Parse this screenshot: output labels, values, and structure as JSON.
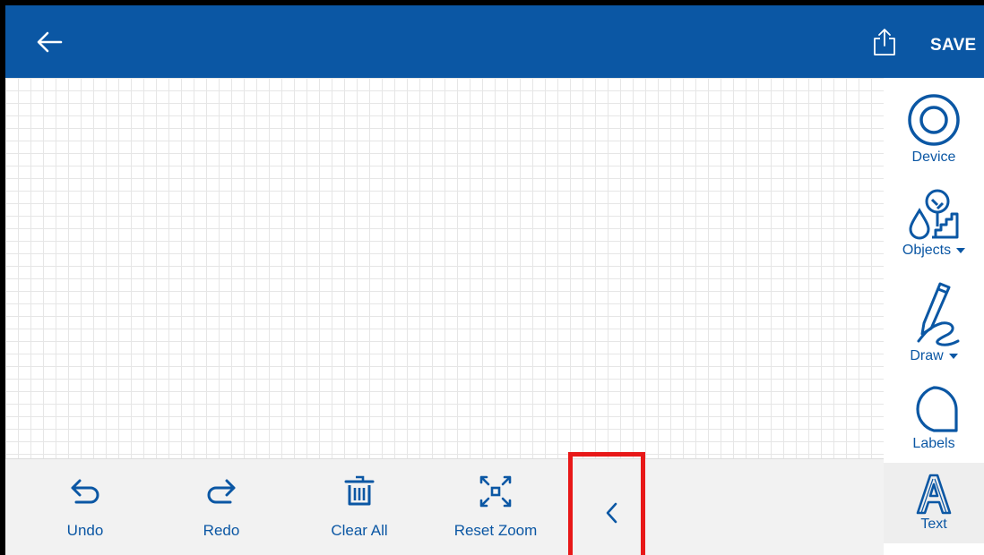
{
  "appbar": {
    "save_label": "SAVE",
    "color": "#0b57a4"
  },
  "sidebar": {
    "device_label": "Device",
    "objects_label": "Objects",
    "draw_label": "Draw",
    "labels_label": "Labels",
    "text_label": "Text",
    "selected": "Text"
  },
  "bottombar": {
    "undo_label": "Undo",
    "redo_label": "Redo",
    "clear_all_label": "Clear All",
    "reset_zoom_label": "Reset Zoom"
  },
  "colors": {
    "accent": "#0b57a4",
    "highlight": "#e81818",
    "toolbar_bg": "#f2f2f2"
  },
  "icons": [
    "back-arrow-icon",
    "share-icon",
    "device-icon",
    "objects-icon",
    "draw-icon",
    "labels-icon",
    "text-icon",
    "undo-icon",
    "redo-icon",
    "trash-icon",
    "reset-zoom-icon",
    "chevron-left-icon"
  ]
}
